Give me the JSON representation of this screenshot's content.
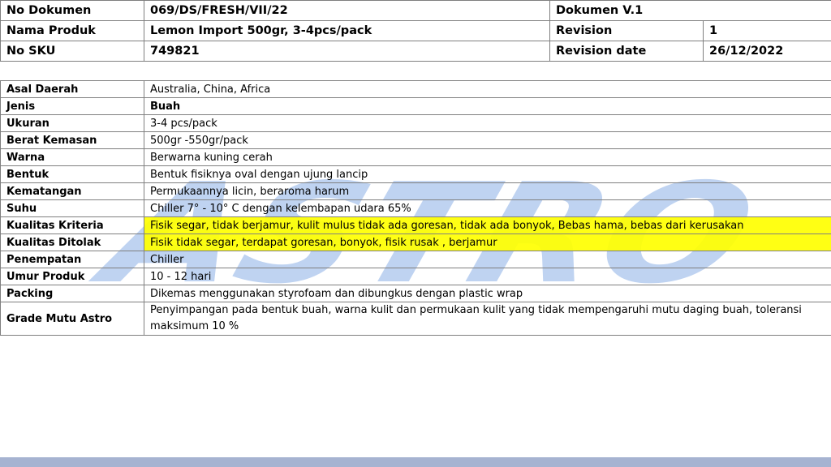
{
  "header": {
    "doc_no_label": "No Dokumen",
    "doc_no_value": "069/DS/FRESH/VII/22",
    "doc_version": "Dokumen V.1",
    "product_name_label": "Nama Produk",
    "product_name_value": "Lemon Import 500gr, 3-4pcs/pack",
    "revision_label": "Revision",
    "revision_value": "1",
    "sku_label": "No SKU",
    "sku_value": "749821",
    "revision_date_label": "Revision date",
    "revision_date_value": "26/12/2022"
  },
  "specs": [
    {
      "label": "Asal Daerah",
      "value": "Australia, China, Africa"
    },
    {
      "label": "Jenis",
      "value": "Buah"
    },
    {
      "label": "Ukuran",
      "value": "3-4 pcs/pack"
    },
    {
      "label": "Berat Kemasan",
      "value": "500gr -550gr/pack"
    },
    {
      "label": "Warna",
      "value": "Berwarna kuning cerah"
    },
    {
      "label": "Bentuk",
      "value": "Bentuk fisiknya oval dengan ujung lancip"
    },
    {
      "label": "Kematangan",
      "value": "Permukaannya licin, beraroma harum"
    },
    {
      "label": "Suhu",
      "value": "Chiller 7° - 10° C dengan kelembapan udara 65%"
    },
    {
      "label": "Kualitas Kriteria",
      "value": "Fisik segar, tidak berjamur, kulit mulus tidak ada goresan, tidak ada bonyok, Bebas hama, bebas dari kerusakan"
    },
    {
      "label": "Kualitas Ditolak",
      "value": "Fisik tidak segar, terdapat goresan, bonyok, fisik rusak , berjamur"
    },
    {
      "label": "Penempatan",
      "value": "Chiller"
    },
    {
      "label": "Umur Produk",
      "value": "10 - 12 hari"
    },
    {
      "label": "Packing",
      "value": "Dikemas menggunakan styrofoam dan dibungkus dengan plastic wrap"
    },
    {
      "label": "Grade Mutu Astro",
      "value": "Penyimpangan pada bentuk buah, warna kulit dan permukaan kulit yang tidak mempengaruhi mutu daging buah, toleransi maksimum 10 %"
    }
  ],
  "watermark": {
    "text": "ASTRO",
    "color": "#a9c4ec"
  },
  "highlight_color": "#ffff00"
}
